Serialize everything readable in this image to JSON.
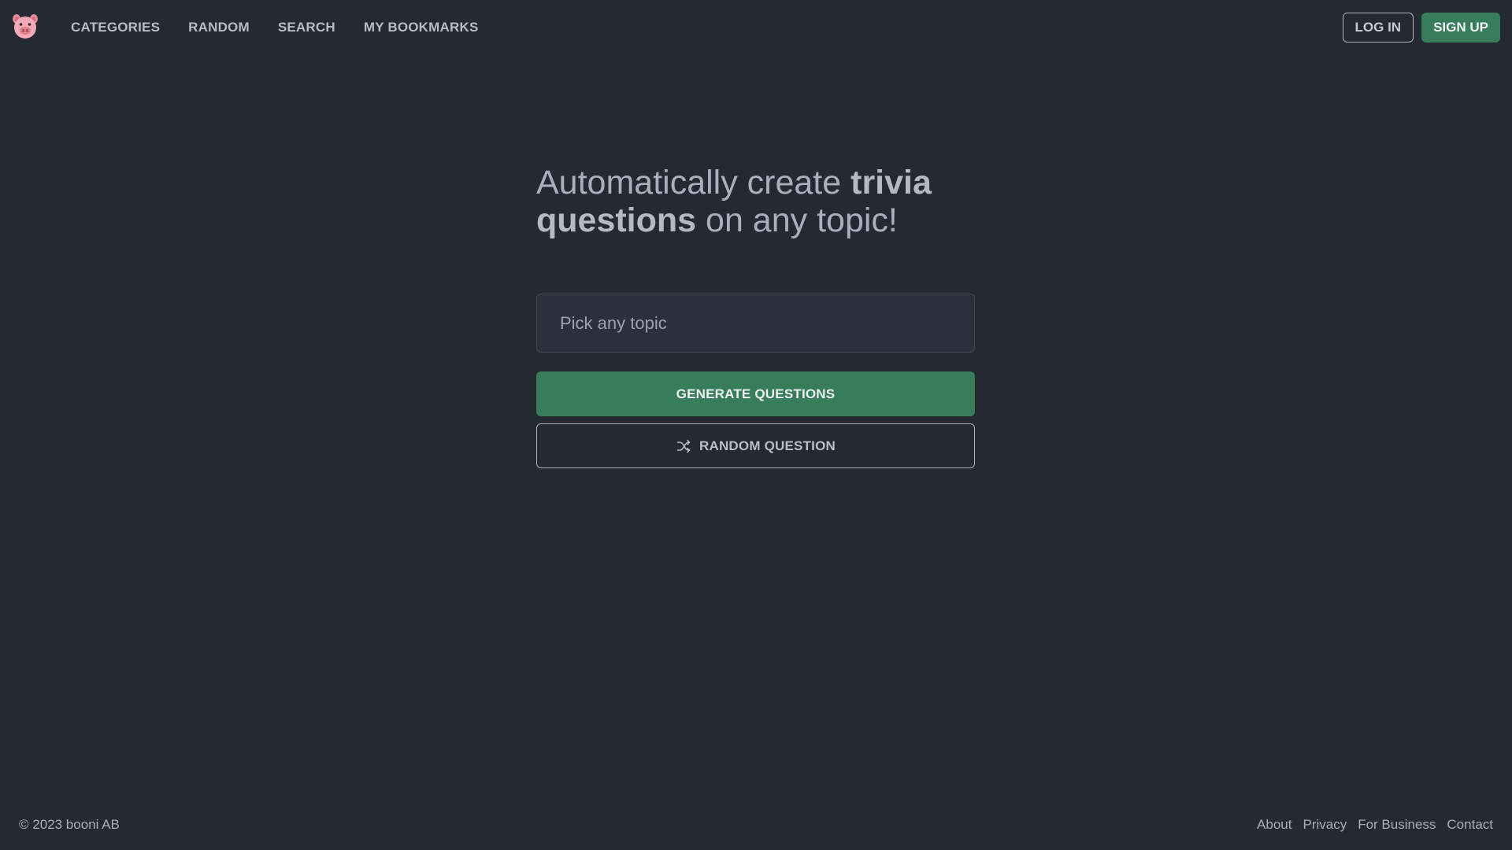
{
  "header": {
    "logo_icon": "pig-face-icon",
    "nav": [
      {
        "label": "CATEGORIES"
      },
      {
        "label": "RANDOM"
      },
      {
        "label": "SEARCH"
      },
      {
        "label": "MY BOOKMARKS"
      }
    ],
    "login_label": "LOG IN",
    "signup_label": "SIGN UP"
  },
  "hero": {
    "headline_part1": "Automatically create ",
    "headline_bold": "trivia questions",
    "headline_part2": " on any topic!"
  },
  "topic_input": {
    "placeholder": "Pick any topic",
    "value": ""
  },
  "actions": {
    "generate_label": "GENERATE QUESTIONS",
    "random_label": "RANDOM QUESTION",
    "random_icon": "shuffle-icon"
  },
  "footer": {
    "copyright": "© 2023 booni AB",
    "links": [
      {
        "label": "About"
      },
      {
        "label": "Privacy"
      },
      {
        "label": "For Business"
      },
      {
        "label": "Contact"
      }
    ]
  },
  "colors": {
    "background": "#252932",
    "accent_green": "#377d5c",
    "text_muted": "#a9afbb"
  }
}
